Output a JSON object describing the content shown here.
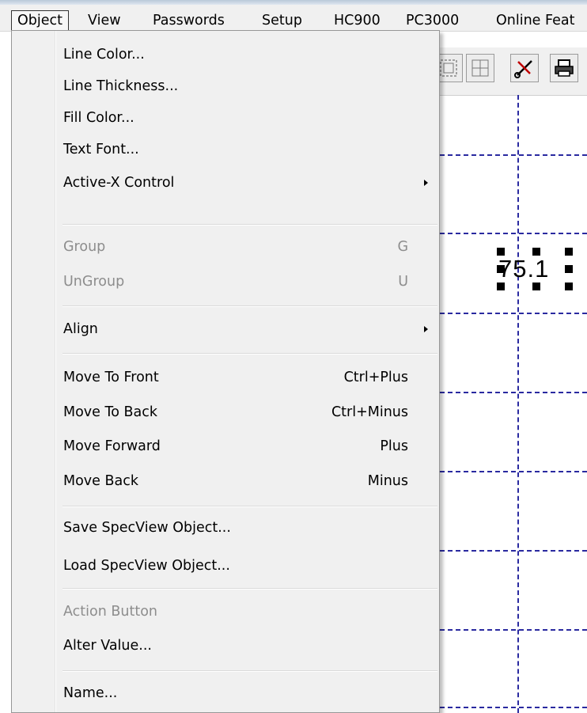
{
  "menubar": {
    "items": [
      "Object",
      "View",
      "Passwords",
      "Setup",
      "HC900",
      "PC3000",
      "Online Feat"
    ],
    "open_item": "Object"
  },
  "canvas": {
    "value_object_text": "75.1",
    "grid_color": "#2a2aa0"
  },
  "toolbar": {
    "icons": [
      "group-objects-icon",
      "ungroup-objects-icon",
      "cut-icon",
      "print-icon"
    ]
  },
  "object_menu": {
    "items": [
      {
        "label": "Line Color...",
        "shortcut": "",
        "enabled": true,
        "submenu": false
      },
      {
        "label": "Line Thickness...",
        "shortcut": "",
        "enabled": true,
        "submenu": false
      },
      {
        "label": "Fill Color...",
        "shortcut": "",
        "enabled": true,
        "submenu": false
      },
      {
        "label": "Text Font...",
        "shortcut": "",
        "enabled": true,
        "submenu": false
      },
      {
        "label": "Active-X Control",
        "shortcut": "",
        "enabled": true,
        "submenu": true
      },
      {
        "label": "Group",
        "shortcut": "G",
        "enabled": false,
        "submenu": false
      },
      {
        "label": "UnGroup",
        "shortcut": "U",
        "enabled": false,
        "submenu": false
      },
      {
        "label": "Align",
        "shortcut": "",
        "enabled": true,
        "submenu": true
      },
      {
        "label": "Move To Front",
        "shortcut": "Ctrl+Plus",
        "enabled": true,
        "submenu": false
      },
      {
        "label": "Move To Back",
        "shortcut": "Ctrl+Minus",
        "enabled": true,
        "submenu": false
      },
      {
        "label": "Move Forward",
        "shortcut": "Plus",
        "enabled": true,
        "submenu": false
      },
      {
        "label": "Move Back",
        "shortcut": "Minus",
        "enabled": true,
        "submenu": false
      },
      {
        "label": "Save SpecView Object...",
        "shortcut": "",
        "enabled": true,
        "submenu": false
      },
      {
        "label": "Load SpecView Object...",
        "shortcut": "",
        "enabled": true,
        "submenu": false
      },
      {
        "label": "Action Button",
        "shortcut": "",
        "enabled": false,
        "submenu": false
      },
      {
        "label": "Alter Value...",
        "shortcut": "",
        "enabled": true,
        "submenu": false
      },
      {
        "label": "Name...",
        "shortcut": "",
        "enabled": true,
        "submenu": false
      }
    ]
  }
}
